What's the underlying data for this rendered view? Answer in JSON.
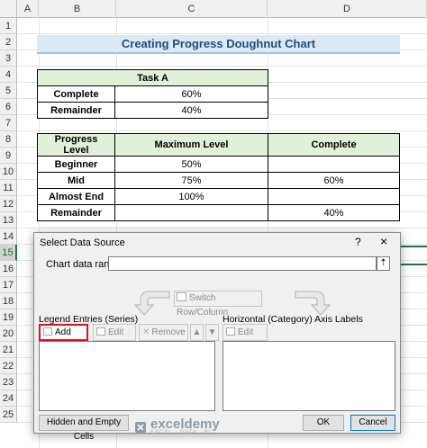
{
  "sheet": {
    "columns": [
      "A",
      "B",
      "C",
      "D"
    ],
    "rows": [
      "1",
      "2",
      "3",
      "4",
      "5",
      "6",
      "7",
      "8",
      "9",
      "10",
      "11",
      "12",
      "13",
      "14",
      "15",
      "16",
      "17",
      "18",
      "19",
      "20",
      "21",
      "22",
      "23",
      "24",
      "25"
    ],
    "selected_row": "15",
    "title": "Creating Progress Doughnut Chart",
    "task_table": {
      "header": "Task A",
      "rows": [
        {
          "label": "Complete",
          "value": "60%"
        },
        {
          "label": "Remainder",
          "value": "40%"
        }
      ]
    },
    "progress_table": {
      "headers": [
        "Progress Level",
        "Maximum Level",
        "Complete"
      ],
      "rows": [
        {
          "label": "Beginner",
          "max": "50%",
          "complete": ""
        },
        {
          "label": "Mid",
          "max": "75%",
          "complete": "60%"
        },
        {
          "label": "Almost End",
          "max": "100%",
          "complete": ""
        },
        {
          "label": "Remainder",
          "max": "",
          "complete": "40%"
        }
      ]
    }
  },
  "dialog": {
    "title": "Select Data Source",
    "help": "?",
    "close": "×",
    "chart_range_label": "Chart data range:",
    "chart_range_value": "",
    "collapse_glyph": "⇡",
    "switch_label": "Switch Row/Column",
    "legend_label": "Legend Entries (Series)",
    "legend_buttons": {
      "add": "Add",
      "edit": "Edit",
      "remove": "Remove"
    },
    "axis_label": "Horizontal (Category) Axis Labels",
    "axis_edit": "Edit",
    "hidden_cells": "Hidden and Empty Cells",
    "ok": "OK",
    "cancel": "Cancel"
  },
  "watermark": {
    "name": "exceldemy",
    "tagline": "EXCEL · DATA · BI"
  },
  "colors": {
    "header_fill": "#e2efda",
    "title_fill": "#dce9f5",
    "title_text": "#1f4e79",
    "highlight": "#d3171c",
    "excel_green": "#217346"
  }
}
